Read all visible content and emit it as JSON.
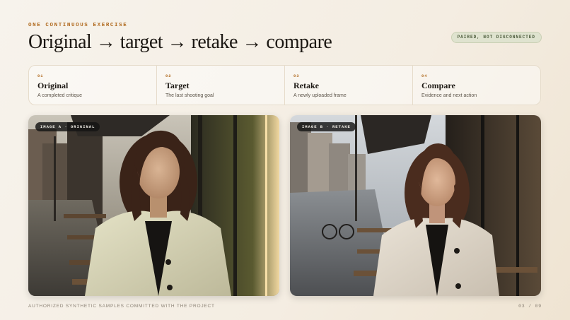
{
  "header": {
    "eyebrow": "ONE CONTINUOUS EXERCISE",
    "title": "Original → target → retake → compare",
    "badge": "PAIRED, NOT DISCONNECTED"
  },
  "steps": [
    {
      "num": "01",
      "title": "Original",
      "sub": "A completed critique"
    },
    {
      "num": "02",
      "title": "Target",
      "sub": "The last shooting goal"
    },
    {
      "num": "03",
      "title": "Retake",
      "sub": "A newly uploaded frame"
    },
    {
      "num": "04",
      "title": "Compare",
      "sub": "Evidence and next action"
    }
  ],
  "images": {
    "a_label": "IMAGE A · ORIGINAL",
    "b_label": "IMAGE B · RETAKE"
  },
  "footer": {
    "note": "AUTHORIZED SYNTHETIC SAMPLES COMMITTED WITH THE PROJECT",
    "page": "03 / 09"
  },
  "colors": {
    "accent": "#b06a1f",
    "badge_bg": "#dfe3cf",
    "badge_text": "#4b5a3a"
  }
}
